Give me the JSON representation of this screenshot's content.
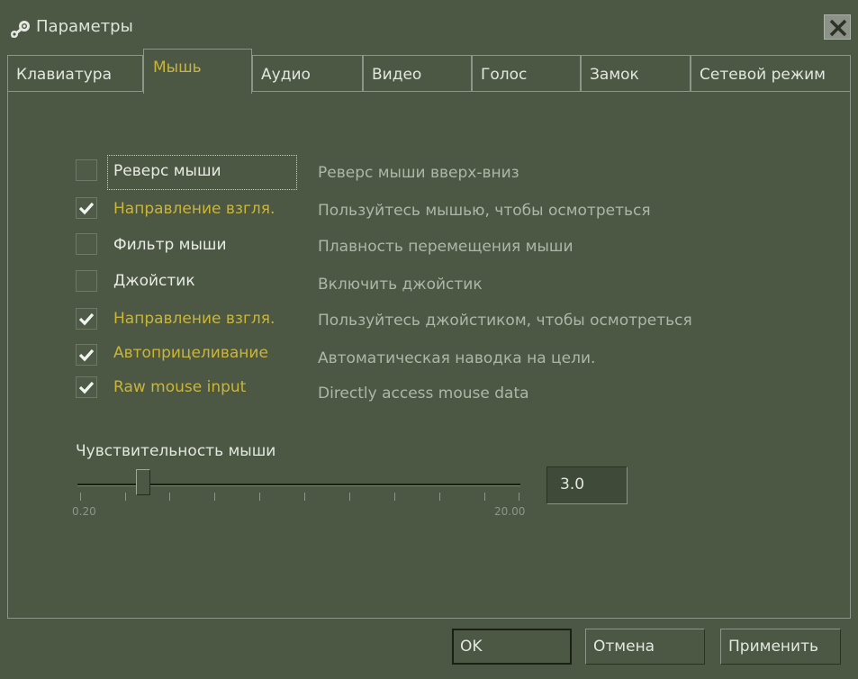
{
  "window": {
    "title": "Параметры",
    "icon": "steam-logo-icon",
    "close_icon": "close-x-icon"
  },
  "tabs": [
    {
      "label": "Клавиатура",
      "active": false
    },
    {
      "label": "Мышь",
      "active": true
    },
    {
      "label": "Аудио",
      "active": false
    },
    {
      "label": "Видео",
      "active": false
    },
    {
      "label": "Голос",
      "active": false
    },
    {
      "label": "Замок",
      "active": false
    },
    {
      "label": "Сетевой режим",
      "active": false
    }
  ],
  "options": [
    {
      "label": "Реверс мыши",
      "checked": false,
      "description": "Реверс мыши вверх-вниз"
    },
    {
      "label": "Направление взгля.",
      "checked": true,
      "description": "Пользуйтесь мышью, чтобы осмотреться"
    },
    {
      "label": "Фильтр мыши",
      "checked": false,
      "description": "Плавность перемещения мыши"
    },
    {
      "label": "Джойстик",
      "checked": false,
      "description": "Включить джойстик"
    },
    {
      "label": "Направление взгля.",
      "checked": true,
      "description": "Пользуйтесь джойстиком, чтобы осмотреться"
    },
    {
      "label": "Автоприцеливание",
      "checked": true,
      "description": "Автоматическая наводка на цели."
    },
    {
      "label": "Raw mouse input",
      "checked": true,
      "description": "Directly access mouse data"
    }
  ],
  "sensitivity": {
    "label": "Чувствительность мыши",
    "min_label": "0.20",
    "max_label": "20.00",
    "value": "3.0"
  },
  "buttons": {
    "ok": "OK",
    "cancel": "Отмена",
    "apply": "Применить"
  },
  "colors": {
    "background": "#4c5844",
    "accent_checked_text": "#c9b53a",
    "description_text": "#aeb6a7"
  }
}
